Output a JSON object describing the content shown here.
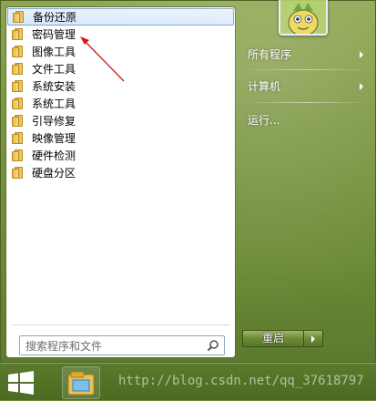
{
  "programs": [
    {
      "label": "备份还原",
      "selected": true
    },
    {
      "label": "密码管理",
      "selected": false
    },
    {
      "label": "图像工具",
      "selected": false
    },
    {
      "label": "文件工具",
      "selected": false
    },
    {
      "label": "系统安装",
      "selected": false
    },
    {
      "label": "系统工具",
      "selected": false
    },
    {
      "label": "引导修复",
      "selected": false
    },
    {
      "label": "映像管理",
      "selected": false
    },
    {
      "label": "硬件检测",
      "selected": false
    },
    {
      "label": "硬盘分区",
      "selected": false
    }
  ],
  "search": {
    "placeholder": "搜索程序和文件"
  },
  "right_menu": {
    "all_programs": "所有程序",
    "computer": "计算机",
    "run": "运行..."
  },
  "shutdown": {
    "label": "重启"
  },
  "watermark": "http://blog.csdn.net/qq_37618797",
  "colors": {
    "menu_green": "#7a9540",
    "selection_border": "#7da2ce",
    "annotation_arrow": "#d01818"
  }
}
